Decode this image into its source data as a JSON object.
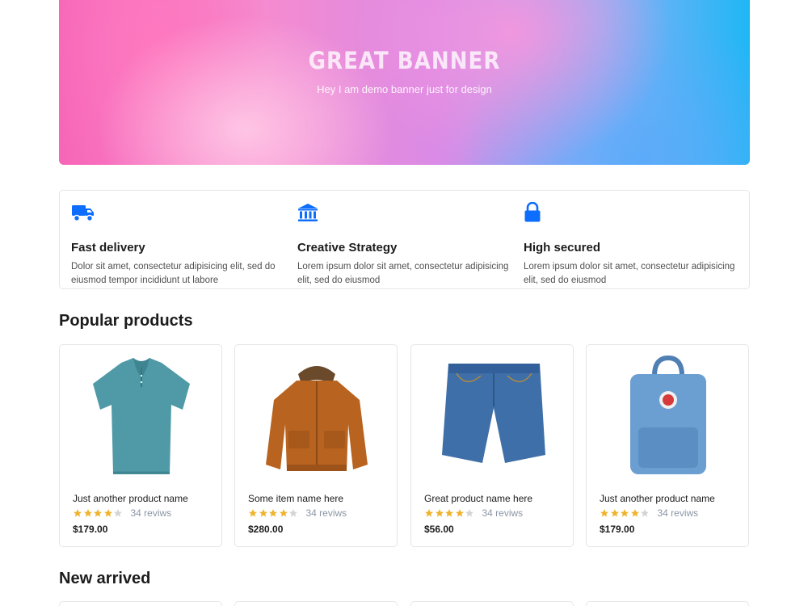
{
  "banner": {
    "title": "GREAT BANNER",
    "subtitle": "Hey I am demo banner just for design"
  },
  "features": [
    {
      "icon": "truck-icon",
      "title": "Fast delivery",
      "text": "Dolor sit amet, consectetur adipisicing elit, sed do eiusmod tempor incididunt ut labore"
    },
    {
      "icon": "bank-icon",
      "title": "Creative Strategy",
      "text": "Lorem ipsum dolor sit amet, consectetur adipisicing elit, sed do eiusmod"
    },
    {
      "icon": "lock-icon",
      "title": "High secured",
      "text": "Lorem ipsum dolor sit amet, consectetur adipisicing elit, sed do eiusmod"
    }
  ],
  "popular": {
    "title": "Popular products",
    "products": [
      {
        "name": "Just another product name",
        "rating": 4,
        "reviews": "34 reviws",
        "price": "$179.00",
        "image": "polo-shirt"
      },
      {
        "name": "Some item name here",
        "rating": 4,
        "reviews": "34 reviws",
        "price": "$280.00",
        "image": "winter-jacket"
      },
      {
        "name": "Great product name here",
        "rating": 4,
        "reviews": "34 reviws",
        "price": "$56.00",
        "image": "denim-shorts"
      },
      {
        "name": "Just another product name",
        "rating": 4,
        "reviews": "34 reviws",
        "price": "$179.00",
        "image": "backpack"
      }
    ]
  },
  "new_arrived": {
    "title": "New arrived"
  },
  "colors": {
    "accent": "#0d6efd",
    "star": "#f0b32e",
    "star_empty": "#d4d4d4"
  }
}
